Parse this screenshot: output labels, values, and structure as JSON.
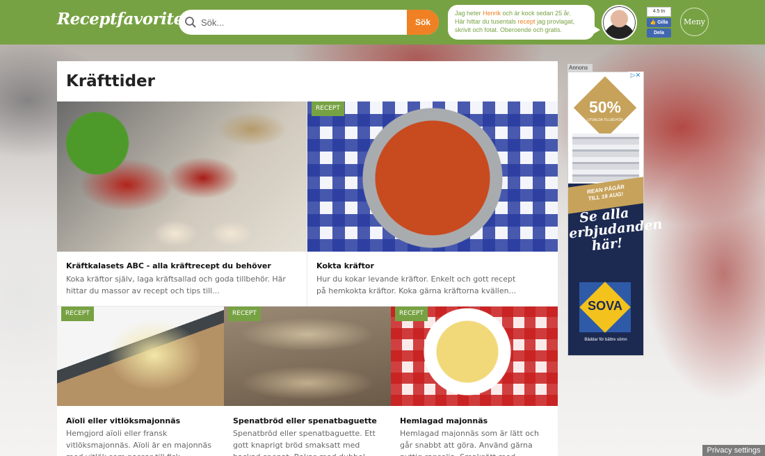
{
  "header": {
    "logo": "Receptfavoriten.se",
    "search": {
      "placeholder": "Sök...",
      "button_label": "Sök"
    },
    "bubble": {
      "line1_a": "Jag heter ",
      "line1_name": "Henrik",
      "line1_b": " och är kock sedan 25 år.",
      "line2_a": "Här hittar du tusentals ",
      "line2_link": "recept",
      "line2_b": " jag provlagat,",
      "line3": "skrivit och fotat. Oberoende och gratis."
    },
    "facebook": {
      "count": "4.5 tn",
      "like_label": "Gilla",
      "share_label": "Dela"
    },
    "menu_label": "Meny"
  },
  "page": {
    "title": "Kräfttider",
    "cards": [
      {
        "badge": "",
        "title": "Kräftkalasets ABC - alla kräftrecept du behöver",
        "desc": "Koka kräftor själv, laga kräftsallad och goda tillbehör. Här hittar du massor av recept och tips till..."
      },
      {
        "badge": "RECEPT",
        "title": "Kokta kräftor",
        "desc": "Hur du kokar levande kräftor. Enkelt och gott recept på hemkokta kräftor. Koka gärna kräftorna kvällen..."
      },
      {
        "badge": "RECEPT",
        "title": "Aïoli eller vitlöksmajonnäs",
        "desc": "Hemgjord aïoli eller fransk vitlöksmajonnäs. Aïoli är en majonnäs med vitlök som passar till fisk,"
      },
      {
        "badge": "RECEPT",
        "title": "Spenatbröd eller spenatbaguette",
        "desc": "Spenatbröd eller spenatbaguette. Ett gott knaprigt bröd smaksatt med hackad spenat. Bakas med dubbel jäsning"
      },
      {
        "badge": "RECEPT",
        "title": "Hemlagad majonnäs",
        "desc": "Hemlagad majonnäs som är lätt och går snabbt att göra. Använd gärna nyttig rapsolja. Smaksätt med"
      }
    ]
  },
  "ad": {
    "label": "Annons",
    "close": "▷✕",
    "percent": "50%",
    "percent_sub": "UTVALDA TILLBEHÖR",
    "sale_line1": "REAN PÅGÅR",
    "sale_line2": "TILL 19 AUG!",
    "script_text": "Se alla erbjudanden här!",
    "brand": "SOVA",
    "tagline": "Bäddar för bättre sömn"
  },
  "privacy_label": "Privacy settings",
  "colors": {
    "brand_green": "#77a243",
    "accent_orange": "#ef8124"
  }
}
